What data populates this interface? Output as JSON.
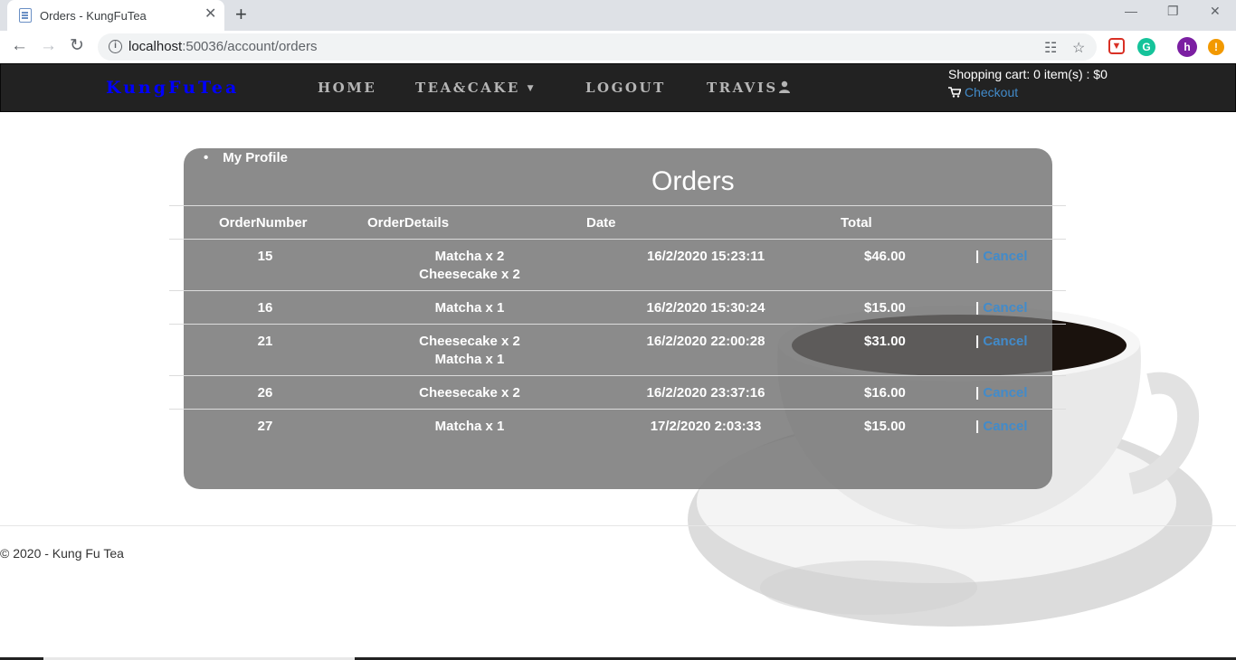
{
  "browser": {
    "tab_title": "Orders - KungFuTea",
    "tab_close": "✕",
    "new_tab": "+",
    "url_host": "localhost",
    "url_rest": ":50036/account/orders",
    "profile_initial": "h",
    "ext_alert": "!"
  },
  "navbar": {
    "brand": "KungFuTea",
    "links": [
      "Home",
      "Tea&Cake",
      "Logout",
      "Travis"
    ],
    "cart_summary": "Shopping cart: 0 item(s) : $0",
    "checkout": "Checkout"
  },
  "sidebar": {
    "profile_link": "My Profile"
  },
  "orders": {
    "title": "Orders",
    "columns": [
      "OrderNumber",
      "OrderDetails",
      "Date",
      "Total"
    ],
    "rows": [
      {
        "number": "15",
        "details": [
          "Matcha x 2",
          "Cheesecake x 2"
        ],
        "date": "16/2/2020 15:23:11",
        "total": "$46.00",
        "action": "Cancel"
      },
      {
        "number": "16",
        "details": [
          "Matcha x 1"
        ],
        "date": "16/2/2020 15:30:24",
        "total": "$15.00",
        "action": "Cancel"
      },
      {
        "number": "21",
        "details": [
          "Cheesecake x 2",
          "Matcha x 1"
        ],
        "date": "16/2/2020 22:00:28",
        "total": "$31.00",
        "action": "Cancel"
      },
      {
        "number": "26",
        "details": [
          "Cheesecake x 2"
        ],
        "date": "16/2/2020 23:37:16",
        "total": "$16.00",
        "action": "Cancel"
      },
      {
        "number": "27",
        "details": [
          "Matcha x 1"
        ],
        "date": "17/2/2020 2:03:33",
        "total": "$15.00",
        "action": "Cancel"
      }
    ]
  },
  "footer": {
    "text": "© 2020 - Kung Fu Tea"
  }
}
